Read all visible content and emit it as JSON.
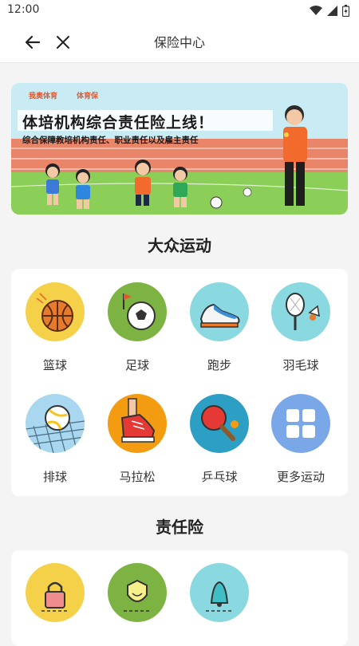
{
  "status_bar": {
    "time": "12:00"
  },
  "nav": {
    "title": "保险中心"
  },
  "banner": {
    "logo_1": "我奥体育",
    "logo_2": "体育保",
    "headline": "体培机构综合责任险上线！",
    "subline": "综合保障教培机构责任、职业责任以及雇主责任"
  },
  "sports_section": {
    "title": "大众运动",
    "items": [
      {
        "label": "篮球",
        "icon": "basketball-icon",
        "color": "#f5d14a"
      },
      {
        "label": "足球",
        "icon": "soccer-icon",
        "color": "#7cb342"
      },
      {
        "label": "跑步",
        "icon": "running-shoe-icon",
        "color": "#8ad8e0"
      },
      {
        "label": "羽毛球",
        "icon": "badminton-icon",
        "color": "#8ad8e0"
      },
      {
        "label": "排球",
        "icon": "volleyball-icon",
        "color": "#a9d7f0"
      },
      {
        "label": "马拉松",
        "icon": "marathon-shoe-icon",
        "color": "#f39c12"
      },
      {
        "label": "乒乓球",
        "icon": "ping-pong-icon",
        "color": "#2e9fc4"
      },
      {
        "label": "更多运动",
        "icon": "more-grid-icon",
        "color": "#7aa7e8"
      }
    ]
  },
  "liability_section": {
    "title": "责任险",
    "items": [
      {
        "icon": "lock-icon",
        "color": "#f5d14a"
      },
      {
        "icon": "shield-icon",
        "color": "#7cb342"
      },
      {
        "icon": "bell-icon",
        "color": "#8ad8e0"
      }
    ]
  }
}
